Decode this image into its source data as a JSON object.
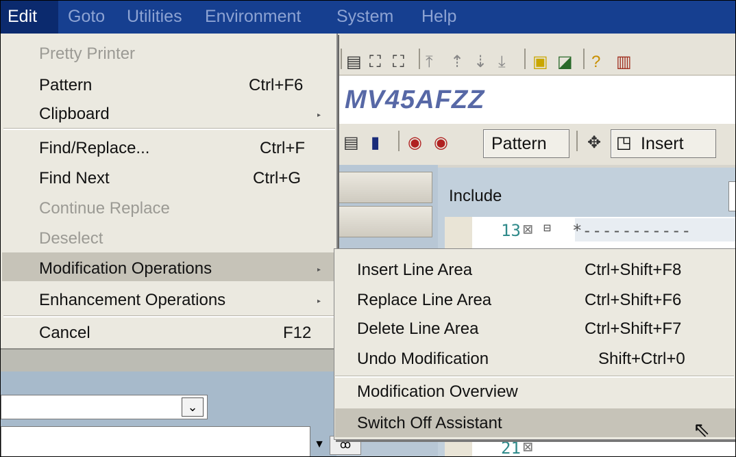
{
  "menubar": {
    "items": [
      "Edit",
      "Goto",
      "Utilities",
      "Environment",
      "System",
      "Help"
    ]
  },
  "window": {
    "title": "MV45AFZZ"
  },
  "toolbar2": {
    "pattern_label": "Pattern",
    "insert_label": "Insert"
  },
  "include_panel": {
    "label": "Include"
  },
  "editor": {
    "lines": [
      {
        "number": "13",
        "text": "*-----------"
      },
      {
        "number": "21",
        "text": ""
      }
    ]
  },
  "edit_menu": {
    "items": [
      {
        "label": "Pretty Printer",
        "shortcut": "",
        "disabled": true
      },
      {
        "label": "Pattern",
        "shortcut": "Ctrl+F6",
        "disabled": false
      },
      {
        "label": "Clipboard",
        "shortcut": "",
        "submenu": true
      },
      {
        "label": "Find/Replace...",
        "shortcut": "Ctrl+F"
      },
      {
        "label": "Find Next",
        "shortcut": "Ctrl+G"
      },
      {
        "label": "Continue Replace",
        "shortcut": "",
        "disabled": true
      },
      {
        "label": "Deselect",
        "shortcut": "",
        "disabled": true
      },
      {
        "label": "Modification Operations",
        "shortcut": "",
        "submenu": true,
        "highlighted": true
      },
      {
        "label": "Enhancement Operations",
        "shortcut": "",
        "submenu": true
      },
      {
        "label": "Cancel",
        "shortcut": "F12"
      }
    ]
  },
  "modification_submenu": {
    "items": [
      {
        "label": "Insert Line Area",
        "shortcut": "Ctrl+Shift+F8"
      },
      {
        "label": "Replace Line Area",
        "shortcut": "Ctrl+Shift+F6"
      },
      {
        "label": "Delete Line Area",
        "shortcut": "Ctrl+Shift+F7"
      },
      {
        "label": "Undo Modification",
        "shortcut": "Shift+Ctrl+0"
      },
      {
        "label": "Modification Overview",
        "shortcut": ""
      },
      {
        "label": "Switch Off Assistant",
        "shortcut": "",
        "highlighted": true
      }
    ]
  },
  "icons": {
    "submenu_arrow": "submenu-arrow-icon",
    "dropdown": "chevron-down-icon",
    "cursor": "mouse-pointer-icon"
  },
  "colors": {
    "menubar": "#163f90",
    "menu_bg": "#ebe9e0",
    "highlight": "#c6c3b8",
    "title": "#5768a6"
  }
}
